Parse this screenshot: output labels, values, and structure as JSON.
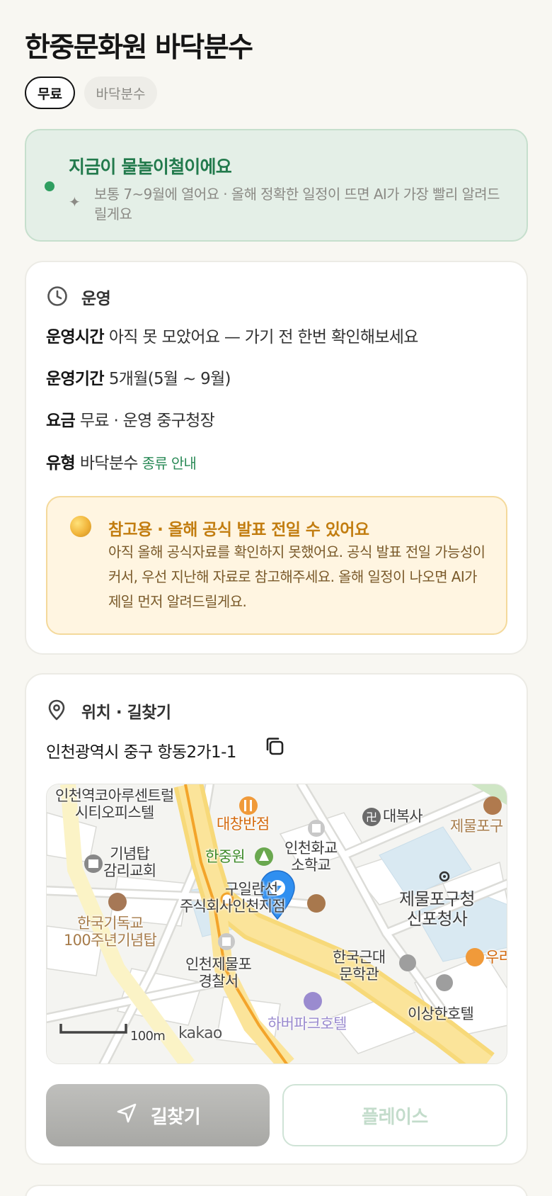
{
  "header": {
    "title": "한중문화원 바닥분수",
    "chips": {
      "price": "무료",
      "type": "바닥분수"
    }
  },
  "season": {
    "headline": "지금이 물놀이철이에요",
    "note": "보통 7~9월에 열어요 · 올해 정확한 일정이 뜨면 AI가 가장 빨리 알려드릴게요",
    "status_color": "#2f9e60"
  },
  "operation": {
    "section_title": "운영",
    "rows": [
      {
        "key": "운영시간",
        "value": "아직 못 모았어요 — 가기 전 한번 확인해보세요"
      },
      {
        "key": "운영기간",
        "value": "5개월(5월 ~ 9월)"
      },
      {
        "key": "요금",
        "value": "무료 · 운영 중구청장"
      },
      {
        "key": "유형",
        "value": "바닥분수",
        "link": "종류 안내"
      }
    ],
    "notice": {
      "title": "참고용 · 올해 공식 발표 전일 수 있어요",
      "body": "아직 올해 공식자료를 확인하지 못했어요. 공식 발표 전일 가능성이 커서, 우선 지난해 자료로 참고해주세요. 올해 일정이 나오면 AI가 제일 먼저 알려드릴게요."
    }
  },
  "location": {
    "section_title": "위치 · 길찾기",
    "address": "인천광역시 중구 항동2가1-1",
    "map": {
      "labels": {
        "l1": "인천역코아루센트럴\n시티오피스텔",
        "l2": "대창반점",
        "l3": "대복사",
        "l4": "제물포구",
        "l5": "기념탑\n감리교회",
        "l6": "한중원",
        "l7": "인천화교\n소학교",
        "l8": "제물포구청\n신포청사",
        "l9": "구일란선",
        "l10": "주식회사인천지점",
        "l11": "한국기독교\n100주년기념탑",
        "l12": "인천제물포\n경찰서",
        "l13": "한국근대\n문학관",
        "l14": "우리",
        "l15": "이상한호텔",
        "l16": "하버파크호텔",
        "scale": "100m",
        "brand": "kakao"
      }
    },
    "buttons": {
      "directions": "길찾기",
      "place": "플레이스"
    }
  },
  "colors": {
    "accent_green": "#227a4c",
    "notice_title": "#c27d10",
    "pin_blue": "#2f8ff0"
  },
  "icons": [
    "clock-icon",
    "pin-icon",
    "copy-icon",
    "navigate-icon",
    "map-marker-icon"
  ]
}
